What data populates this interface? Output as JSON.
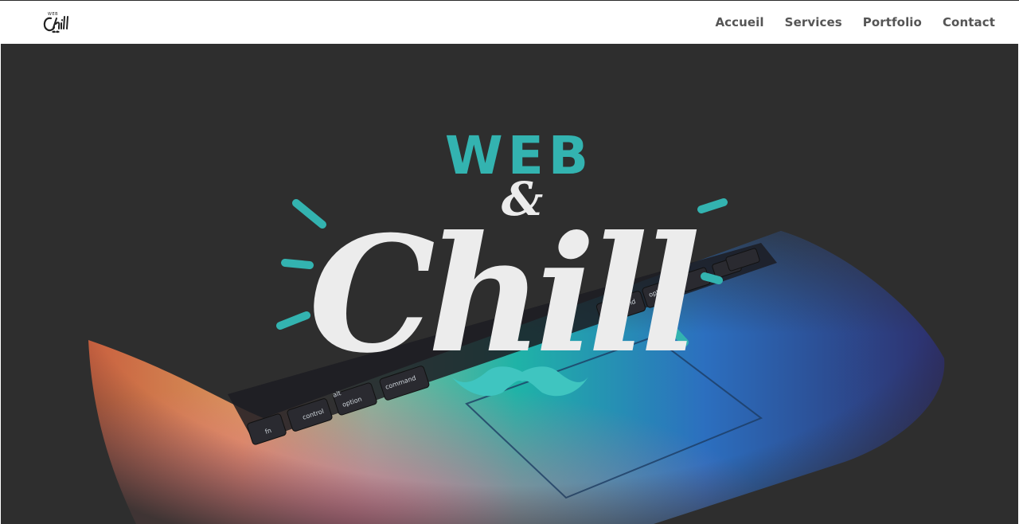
{
  "header": {
    "logo_alt": "Web & Chill",
    "nav": [
      {
        "label": "Accueil"
      },
      {
        "label": "Services"
      },
      {
        "label": "Portfolio"
      },
      {
        "label": "Contact"
      }
    ]
  },
  "hero": {
    "title_top": "WEB",
    "title_amp": "&",
    "title_main": "Chill",
    "keyboard_keys": [
      "fn",
      "control",
      "option",
      "command",
      "command",
      "option"
    ],
    "key_alt_label": "alt",
    "colors": {
      "teal": "#33b3b0",
      "background": "#2e2e2e",
      "script_white": "#ececec",
      "mustache": "#3fc5c0"
    }
  },
  "icons": [
    "logo-icon",
    "mustache-icon"
  ]
}
